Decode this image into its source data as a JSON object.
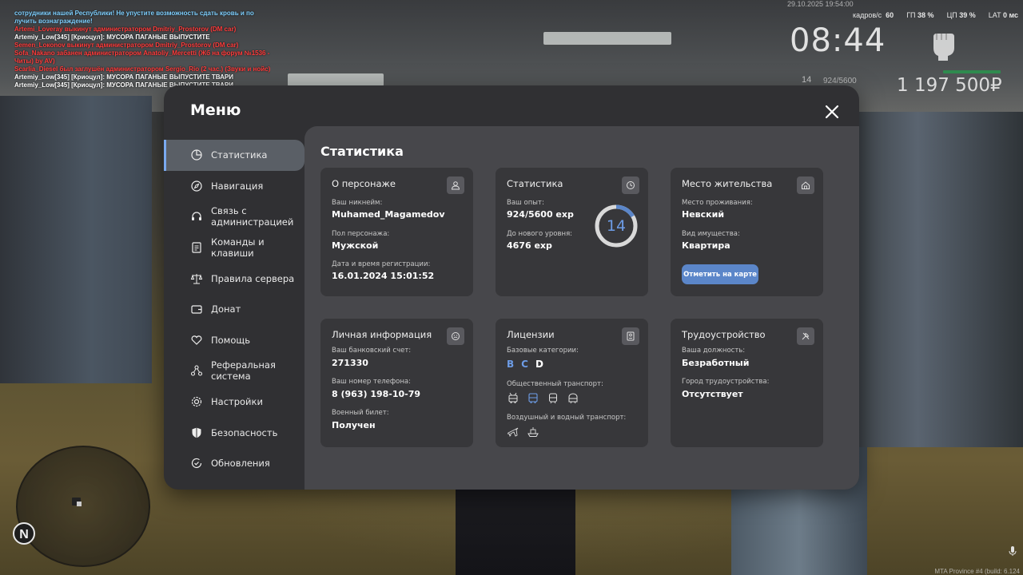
{
  "chat": [
    {
      "text": " сотрудники нашей Республики! Не упустите возможность сдать кровь и по",
      "color": "#7fd0ff"
    },
    {
      "text": " лучить вознаграждение!",
      "color": "#7fd0ff"
    },
    {
      "text": "Artemi_Loveray выкинут администратором Dmitriy_Prostorov (DM car)",
      "color": "#ff3b3b"
    },
    {
      "text": "Artemiy_Low[345] [Криоцул]: МУСОРА ПАГАНЫЕ ВЫПУСТИТЕ",
      "color": "#ffffff"
    },
    {
      "text": "Semen_Loкonov выкинут администратором Dmitriy_Prostorov (DM car)",
      "color": "#ff3b3b"
    },
    {
      "text": "Sofa_Nakano забанен администратором Anatoliy_Mercetti (Жб на форум №1536 -",
      "color": "#ff3b3b"
    },
    {
      "text": "Читы) by AV)",
      "color": "#ff3b3b"
    },
    {
      "text": "Scarlia_Diesel был заглушён администратором Sergio_Rio (2 час.) (Звуки и нойс)",
      "color": "#ff3b3b"
    },
    {
      "text": "Artemiy_Low[345] [Криоцул]: МУСОРА ПАГАНЫЕ ВЫПУСТИТЕ ТВАРИ",
      "color": "#ffffff"
    },
    {
      "text": "Artemiy_Low[345] [Криоцул]: МУСОРА ПАГАНЫЕ ВЫПУСТИТЕ ТВАРИ",
      "color": "#ffffff"
    }
  ],
  "hud": {
    "datetime": "29.10.2025 19:54:00",
    "fps_label": "кадров/с",
    "fps_value": "60",
    "gpu_label": "ГП",
    "gpu_value": "38 %",
    "cpu_label": "ЦП",
    "cpu_value": "39 %",
    "lat_label": "LAT",
    "lat_value": "0 мс",
    "time": "08:44",
    "level": "14",
    "exp": "924/5600",
    "money": "1 197 500₽",
    "footer": "MTA Province #4 (build: 6.124"
  },
  "minimap": {
    "north_label": "N"
  },
  "menu": {
    "title": "Меню",
    "sidebar": [
      {
        "label": "Статистика",
        "icon": "pie-chart-icon",
        "active": true
      },
      {
        "label": "Навигация",
        "icon": "compass-icon"
      },
      {
        "label": "Связь с администрацией",
        "icon": "headset-icon"
      },
      {
        "label": "Команды и клавиши",
        "icon": "document-icon"
      },
      {
        "label": "Правила сервера",
        "icon": "scales-icon"
      },
      {
        "label": "Донат",
        "icon": "wallet-icon"
      },
      {
        "label": "Помощь",
        "icon": "heart-hand-icon"
      },
      {
        "label": "Реферальная система",
        "icon": "referral-icon"
      },
      {
        "label": "Настройки",
        "icon": "gear-icon"
      },
      {
        "label": "Безопасность",
        "icon": "shield-icon"
      },
      {
        "label": "Обновления",
        "icon": "refresh-check-icon"
      }
    ],
    "content_title": "Статистика",
    "cards": {
      "character": {
        "title": "О персонаже",
        "nickname_label": "Ваш никнейм:",
        "nickname": "Muhamed_Magamedov",
        "gender_label": "Пол персонажа:",
        "gender": "Мужской",
        "reg_label": "Дата и время регистрации:",
        "reg": "16.01.2024 15:01:52"
      },
      "stats": {
        "title": "Статистика",
        "exp_label": "Ваш опыт:",
        "exp": "924/5600 exp",
        "next_label": "До нового уровня:",
        "next": "4676 exp",
        "level": "14",
        "progress": 0.165
      },
      "residence": {
        "title": "Место жительства",
        "place_label": "Место проживания:",
        "place": "Невский",
        "property_label": "Вид имущества:",
        "property": "Квартира",
        "button": "Отметить на карте"
      },
      "personal": {
        "title": "Личная информация",
        "bank_label": "Ваш банковский счет:",
        "bank": "271330",
        "phone_label": "Ваш номер телефона:",
        "phone": "8 (963) 198-10-79",
        "military_label": "Военный билет:",
        "military": "Получен"
      },
      "licenses": {
        "title": "Лицензии",
        "base_label": "Базовые категории:",
        "categories": [
          {
            "name": "B",
            "color": "#6d9ce6"
          },
          {
            "name": "C",
            "color": "#6d9ce6"
          },
          {
            "name": "D",
            "color": "#ffffff"
          }
        ],
        "public_label": "Общественный транспорт:",
        "public_icons": [
          "trolleybus-icon",
          "bus-icon",
          "train-icon",
          "metro-icon"
        ],
        "airwater_label": "Воздушный и водный транспорт:",
        "airwater_icons": [
          "airplane-icon",
          "boat-icon"
        ]
      },
      "employment": {
        "title": "Трудоустройство",
        "position_label": "Ваша должность:",
        "position": "Безработный",
        "city_label": "Город трудоустройства:",
        "city": "Отсутствует"
      }
    }
  },
  "colors": {
    "accent": "#6d9ce6",
    "button": "#5b86c9",
    "panel": "#303033",
    "content": "#47474b",
    "card": "#37373a"
  }
}
